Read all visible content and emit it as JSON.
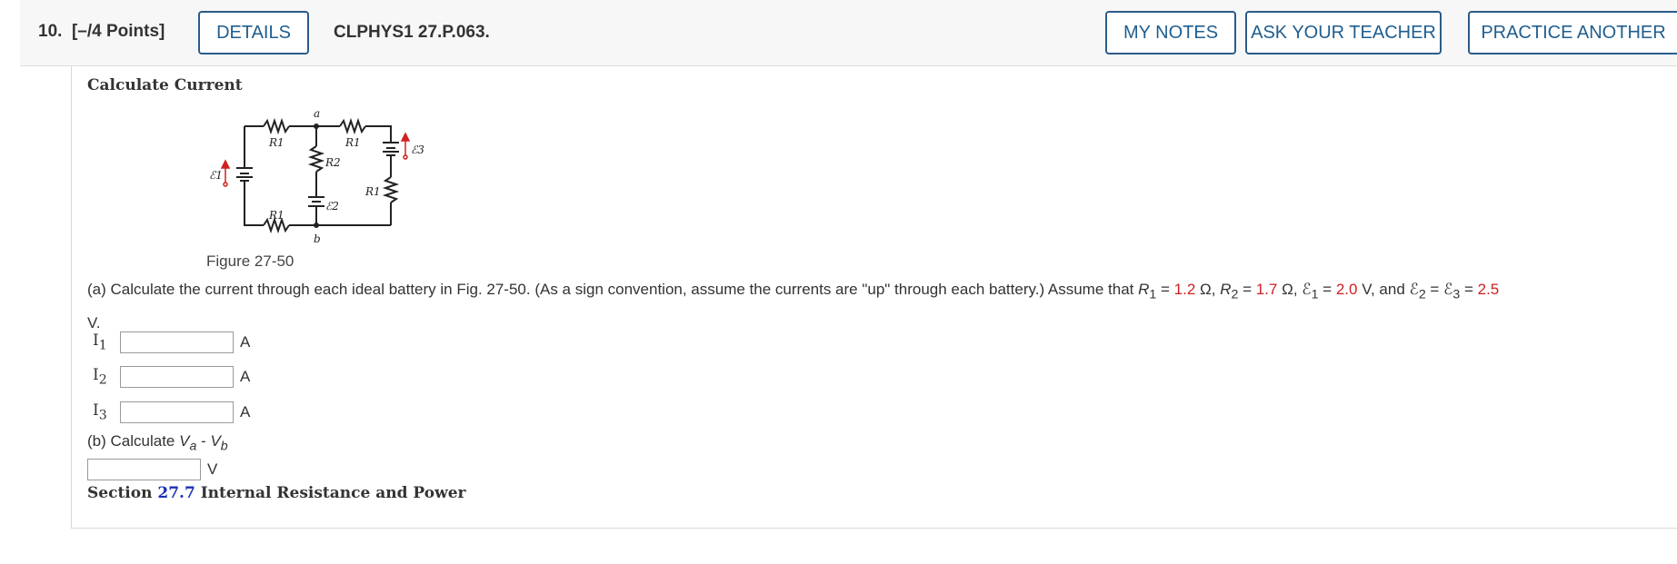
{
  "header": {
    "question_number": "10.",
    "points": "[–/4 Points]",
    "details_label": "DETAILS",
    "question_code": "CLPHYS1 27.P.063.",
    "my_notes_label": "MY NOTES",
    "ask_teacher_label": "ASK YOUR TEACHER",
    "practice_another_label": "PRACTICE ANOTHER"
  },
  "problem": {
    "title": "Calculate Current",
    "figure_caption": "Figure 27-50",
    "figure_labels": {
      "node_a": "a",
      "node_b": "b",
      "r1_top": "R1",
      "r1_right_top": "R1",
      "r1_bottom": "R1",
      "r1_right": "R1",
      "r2": "R2",
      "e1": "ℰ1",
      "e2": "ℰ2",
      "e3": "ℰ3"
    },
    "part_a": {
      "text_before": "(a) Calculate the current through each ideal battery in Fig. 27-50. (As a sign convention, assume the currents are \"up\" through each battery.) Assume that ",
      "r1_symbol": "R",
      "r1_sub": "1",
      "r1_value": "1.2",
      "ohm": "Ω",
      "r2_symbol": "R",
      "r2_sub": "2",
      "r2_value": "1.7",
      "e1_symbol": "ℰ",
      "e1_sub": "1",
      "e1_value": "2.0",
      "volt": "V",
      "and_text": ", and ",
      "e2_symbol": "ℰ",
      "e2_sub": "2",
      "e3_symbol": "ℰ",
      "e3_sub": "3",
      "e23_value": "2.5",
      "trailing": "V."
    },
    "answers": [
      {
        "label": "I",
        "sub": "1",
        "value": "",
        "unit": "A"
      },
      {
        "label": "I",
        "sub": "2",
        "value": "",
        "unit": "A"
      },
      {
        "label": "I",
        "sub": "3",
        "value": "",
        "unit": "A"
      }
    ],
    "part_b": {
      "text": "(b) Calculate ",
      "va": "V",
      "va_sub": "a",
      "minus": " - ",
      "vb": "V",
      "vb_sub": "b",
      "value": "",
      "unit": "V"
    },
    "section": {
      "prefix": "Section ",
      "number": "27.7",
      "title": " Internal Resistance and Power"
    }
  },
  "colors": {
    "button_border": "#2b5c8a",
    "button_text": "#1f5e8f",
    "given_value": "#d02020",
    "section_link": "#1a2fb5",
    "battery_arrow": "#d02020"
  }
}
